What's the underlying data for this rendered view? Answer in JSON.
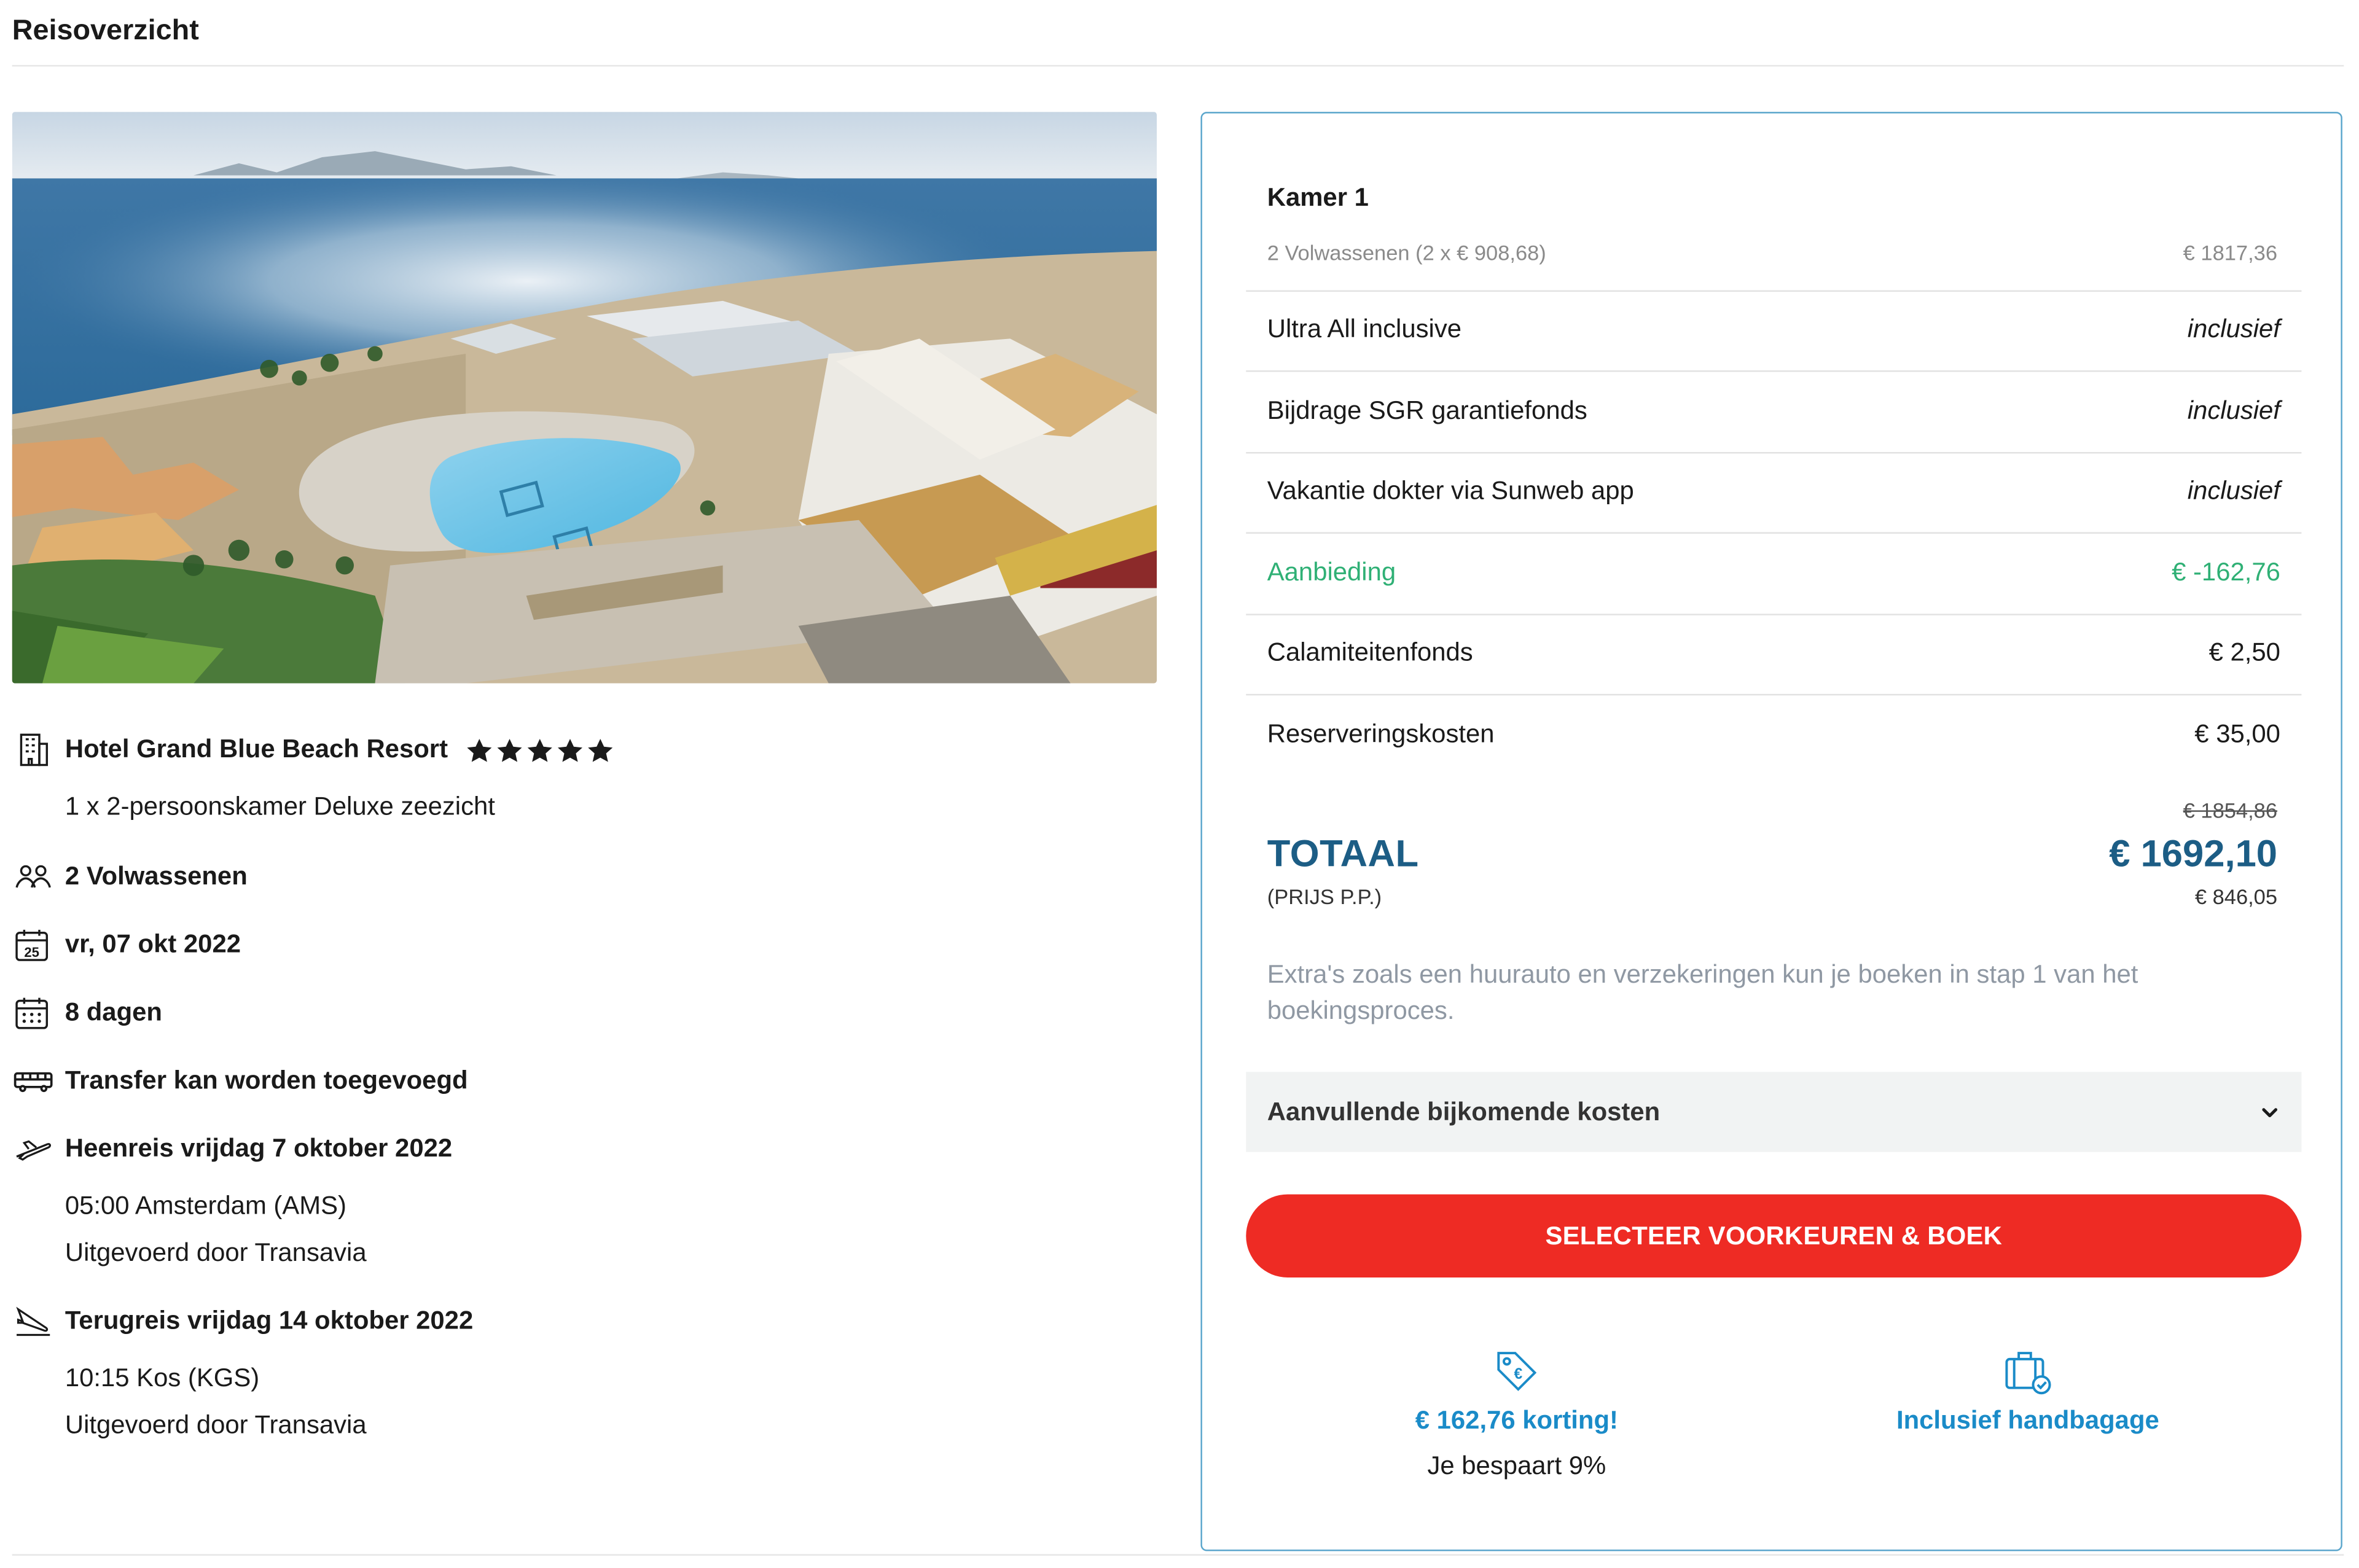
{
  "page": {
    "title": "Reisoverzicht"
  },
  "hotel": {
    "name": "Hotel Grand Blue Beach Resort",
    "stars": 5,
    "room": "1 x 2-persoonskamer Deluxe zeezicht",
    "image_alt": "Hotel Grand Blue Beach Resort"
  },
  "details": {
    "travelers": "2 Volwassenen",
    "date": "vr, 07 okt 2022",
    "date_icon_day": "25",
    "duration": "8 dagen",
    "transfer": "Transfer kan worden toegevoegd",
    "outbound": {
      "title": "Heenreis vrijdag 7 oktober 2022",
      "time_place": "05:00 Amsterdam (AMS)",
      "operator": "Uitgevoerd door Transavia"
    },
    "return": {
      "title": "Terugreis vrijdag 14 oktober 2022",
      "time_place": "10:15 Kos (KGS)",
      "operator": "Uitgevoerd door Transavia"
    }
  },
  "price": {
    "room_title": "Kamer 1",
    "room_sub": "2 Volwassenen (2 x € 908,68)",
    "room_sub_price": "€ 1817,36",
    "rows": [
      {
        "label": "Ultra All inclusive",
        "value": "inclusief"
      },
      {
        "label": "Bijdrage SGR garantiefonds",
        "value": "inclusief"
      },
      {
        "label": "Vakantie dokter via Sunweb app",
        "value": "inclusief"
      },
      {
        "label": "Aanbieding",
        "value": "€ -162,76"
      },
      {
        "label": "Calamiteitenfonds",
        "value": "€ 2,50"
      },
      {
        "label": "Reserveringskosten",
        "value": "€ 35,00"
      }
    ],
    "old_total": "€ 1854,86",
    "total_label": "TOTAAL",
    "total_value": "€ 1692,10",
    "pp_label": "(PRIJS P.P.)",
    "pp_value": "€ 846,05",
    "extras_note": "Extra's zoals een huurauto en verzekeringen kun je boeken in stap 1 van het boekingsproces.",
    "accordion_label": "Aanvullende bijkomende kosten",
    "cta_label": "SELECTEER VOORKEUREN & BOEK"
  },
  "perks": {
    "discount_title": "€ 162,76 korting!",
    "discount_sub": "Je bespaart 9%",
    "baggage_title": "Inclusief handbagage"
  },
  "colors": {
    "brand_blue": "#1c5d85",
    "accent_blue": "#1a8bc8",
    "green": "#2fb075",
    "cta_red": "#ee2b24",
    "card_border": "#5ba6cc"
  },
  "icons": {
    "hotel": "hotel-building-icon",
    "star": "star-icon",
    "travelers": "people-icon",
    "date": "calendar-day-icon",
    "duration": "calendar-grid-icon",
    "transfer": "bus-icon",
    "outbound": "plane-takeoff-icon",
    "return": "plane-landing-icon",
    "accordion": "chevron-down-icon",
    "discount": "price-tag-icon",
    "baggage": "suitcase-check-icon"
  }
}
